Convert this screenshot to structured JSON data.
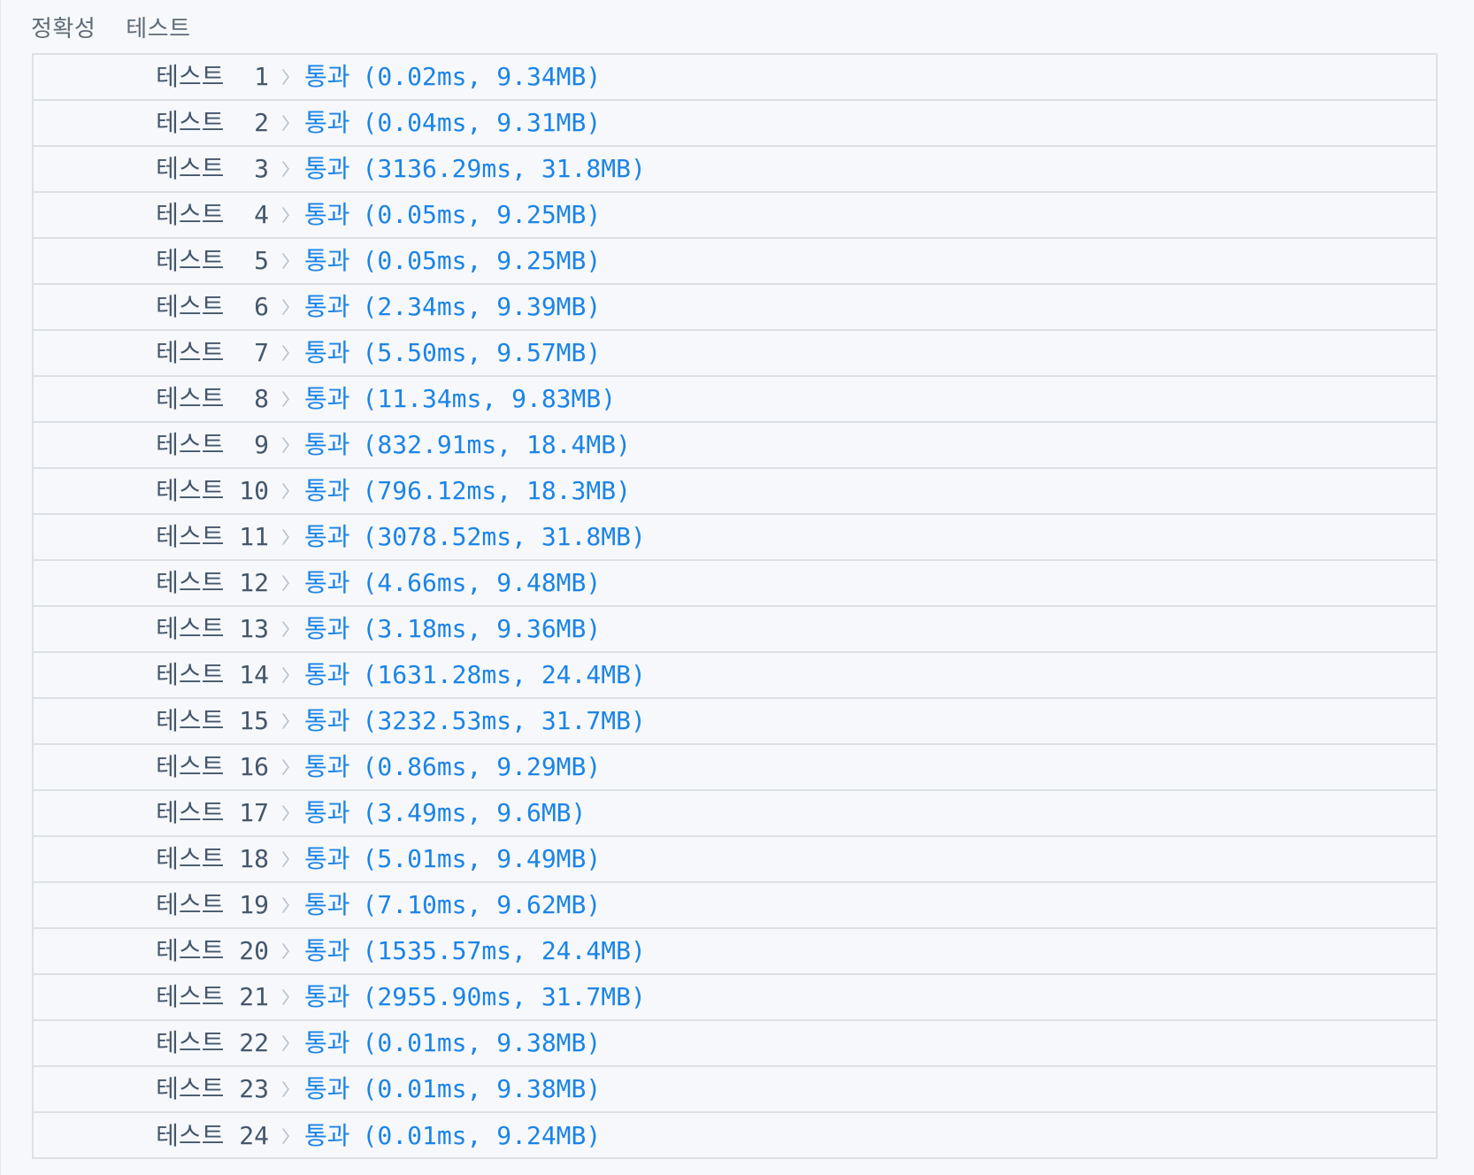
{
  "section": {
    "title_left": "정확성",
    "title_right": "테스트"
  },
  "colors": {
    "text_primary": "#44576c",
    "pass_blue": "#1b84e7",
    "border": "#dce1e7",
    "background": "#f7f8fb"
  },
  "icons": {
    "row_separator": "chevron-right-icon"
  },
  "rows": [
    {
      "label": "테스트  1",
      "status": "통과",
      "metrics": "(0.02ms, 9.34MB)"
    },
    {
      "label": "테스트  2",
      "status": "통과",
      "metrics": "(0.04ms, 9.31MB)"
    },
    {
      "label": "테스트  3",
      "status": "통과",
      "metrics": "(3136.29ms, 31.8MB)"
    },
    {
      "label": "테스트  4",
      "status": "통과",
      "metrics": "(0.05ms, 9.25MB)"
    },
    {
      "label": "테스트  5",
      "status": "통과",
      "metrics": "(0.05ms, 9.25MB)"
    },
    {
      "label": "테스트  6",
      "status": "통과",
      "metrics": "(2.34ms, 9.39MB)"
    },
    {
      "label": "테스트  7",
      "status": "통과",
      "metrics": "(5.50ms, 9.57MB)"
    },
    {
      "label": "테스트  8",
      "status": "통과",
      "metrics": "(11.34ms, 9.83MB)"
    },
    {
      "label": "테스트  9",
      "status": "통과",
      "metrics": "(832.91ms, 18.4MB)"
    },
    {
      "label": "테스트 10",
      "status": "통과",
      "metrics": "(796.12ms, 18.3MB)"
    },
    {
      "label": "테스트 11",
      "status": "통과",
      "metrics": "(3078.52ms, 31.8MB)"
    },
    {
      "label": "테스트 12",
      "status": "통과",
      "metrics": "(4.66ms, 9.48MB)"
    },
    {
      "label": "테스트 13",
      "status": "통과",
      "metrics": "(3.18ms, 9.36MB)"
    },
    {
      "label": "테스트 14",
      "status": "통과",
      "metrics": "(1631.28ms, 24.4MB)"
    },
    {
      "label": "테스트 15",
      "status": "통과",
      "metrics": "(3232.53ms, 31.7MB)"
    },
    {
      "label": "테스트 16",
      "status": "통과",
      "metrics": "(0.86ms, 9.29MB)"
    },
    {
      "label": "테스트 17",
      "status": "통과",
      "metrics": "(3.49ms, 9.6MB)"
    },
    {
      "label": "테스트 18",
      "status": "통과",
      "metrics": "(5.01ms, 9.49MB)"
    },
    {
      "label": "테스트 19",
      "status": "통과",
      "metrics": "(7.10ms, 9.62MB)"
    },
    {
      "label": "테스트 20",
      "status": "통과",
      "metrics": "(1535.57ms, 24.4MB)"
    },
    {
      "label": "테스트 21",
      "status": "통과",
      "metrics": "(2955.90ms, 31.7MB)"
    },
    {
      "label": "테스트 22",
      "status": "통과",
      "metrics": "(0.01ms, 9.38MB)"
    },
    {
      "label": "테스트 23",
      "status": "통과",
      "metrics": "(0.01ms, 9.38MB)"
    },
    {
      "label": "테스트 24",
      "status": "통과",
      "metrics": "(0.01ms, 9.24MB)"
    }
  ]
}
